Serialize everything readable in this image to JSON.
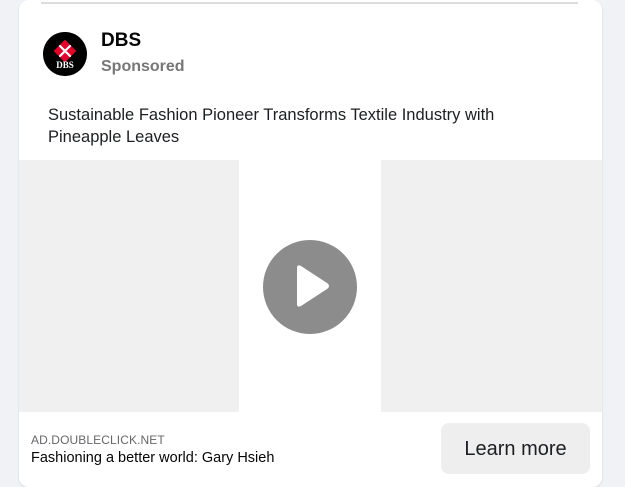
{
  "post": {
    "advertiser_name": "DBS",
    "sponsored_label": "Sponsored",
    "text": "Sustainable Fashion Pioneer Transforms Textile Industry with Pineapple Leaves",
    "logo_icon": "dbs-logo-icon",
    "logo_text": "DBS"
  },
  "media": {
    "play_icon": "play-icon"
  },
  "footer": {
    "domain": "AD.DOUBLECLICK.NET",
    "headline": "Fashioning a better world: Gary Hsieh",
    "cta_label": "Learn more"
  },
  "colors": {
    "brand_red": "#e4002b",
    "play_button_bg": "#8c8c8c",
    "cta_bg": "#eeeeee"
  }
}
